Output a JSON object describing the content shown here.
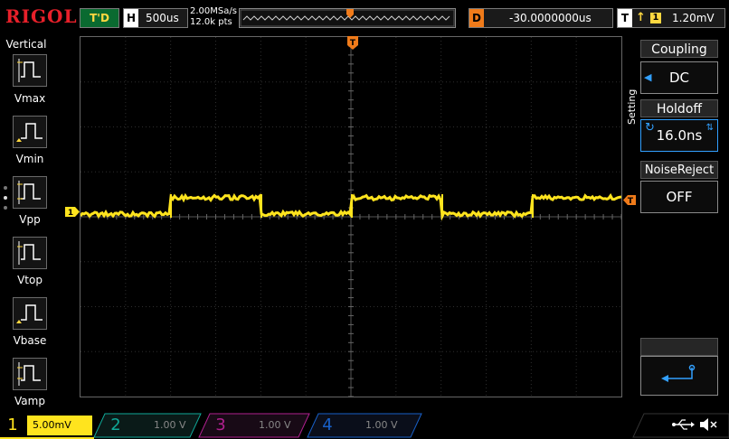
{
  "header": {
    "brand": "RIGOL",
    "trigger_status": "T'D",
    "horizontal": {
      "label": "H",
      "timebase": "500us"
    },
    "sample_rate": "2.00MSa/s",
    "memory_depth": "12.0k pts",
    "delay": {
      "label": "D",
      "value": "-30.0000000us"
    },
    "trigger": {
      "label": "T",
      "edge_symbol": "↑",
      "source": "1",
      "level": "1.20mV"
    }
  },
  "left_panel": {
    "title": "Vertical",
    "measurements": [
      "Vmax",
      "Vmin",
      "Vpp",
      "Vtop",
      "Vbase",
      "Vamp"
    ]
  },
  "right_panel": {
    "tab_label": "Setting",
    "coupling": {
      "label": "Coupling",
      "value": "DC"
    },
    "holdoff": {
      "label": "Holdoff",
      "value": "16.0ns"
    },
    "noise_reject": {
      "label": "NoiseReject",
      "value": "OFF"
    }
  },
  "channels": [
    {
      "num": "1",
      "scale": "5.00mV",
      "color": "#ffe41e",
      "active": true
    },
    {
      "num": "2",
      "scale": "1.00 V",
      "color": "#10a898",
      "active": false
    },
    {
      "num": "3",
      "scale": "1.00 V",
      "color": "#b0208f",
      "active": false
    },
    {
      "num": "4",
      "scale": "1.00 V",
      "color": "#1860c8",
      "active": false
    }
  ],
  "markers": {
    "channel": "1",
    "trigger_pos": "T",
    "trigger_level": "T"
  },
  "colors": {
    "ch1": "#ffe41e",
    "trigger": "#f07b1a",
    "brand": "#e8202a",
    "status": "#0a6a30",
    "accent": "#32a0ff"
  }
}
